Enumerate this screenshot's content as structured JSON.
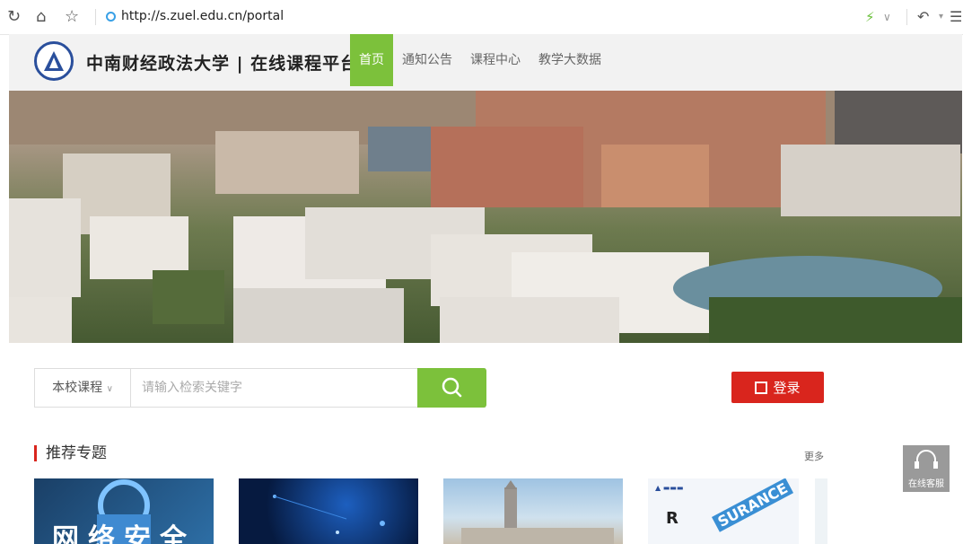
{
  "browser": {
    "url": "http://s.zuel.edu.cn/portal",
    "icons": [
      "reload-icon",
      "home-icon",
      "star-icon",
      "lightning-icon",
      "chevron-down-icon",
      "undo-icon",
      "menu-icon"
    ]
  },
  "site": {
    "name": "中南财经政法大学 | 在线课程平台"
  },
  "nav": [
    {
      "label": "首页",
      "active": true
    },
    {
      "label": "通知公告",
      "active": false
    },
    {
      "label": "课程中心",
      "active": false
    },
    {
      "label": "教学大数据",
      "active": false
    }
  ],
  "search": {
    "scope": "本校课程",
    "placeholder": "请输入检索关键字"
  },
  "login": {
    "label": "登录"
  },
  "recommend": {
    "title": "推荐专题",
    "more": "更多",
    "cards": [
      {
        "text": "网络安全"
      },
      {
        "text": ""
      },
      {
        "text": ""
      },
      {
        "text": "SURANCE"
      },
      {
        "text": ""
      }
    ]
  },
  "service": {
    "label": "在线客服"
  },
  "colors": {
    "accent": "#7cc13b",
    "login": "#d9251d",
    "logo": "#2a4f9c"
  }
}
